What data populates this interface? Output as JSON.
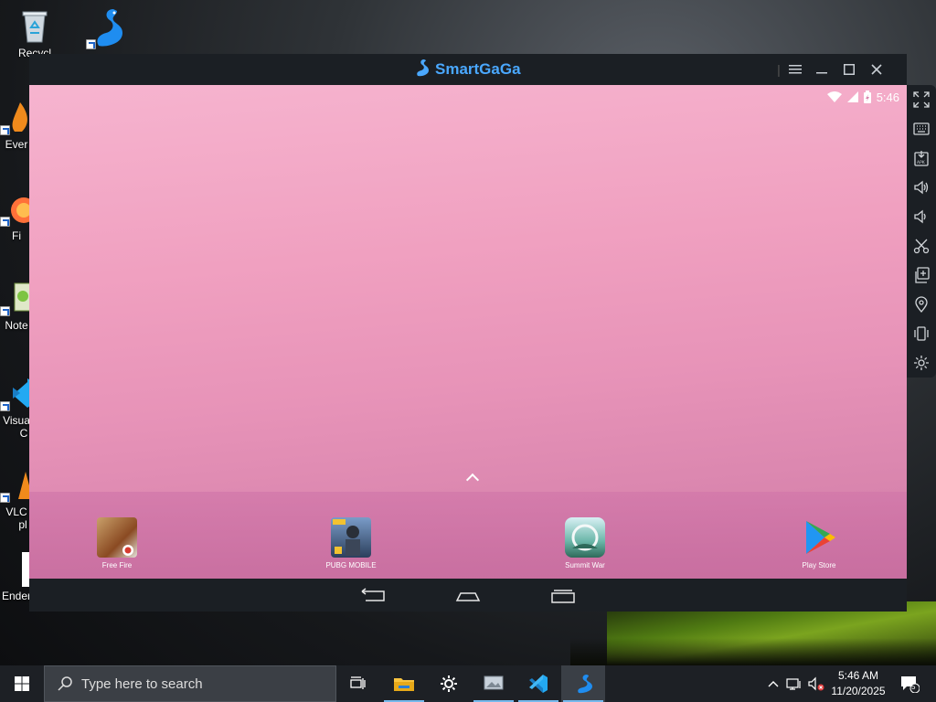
{
  "desktop": {
    "icons": [
      {
        "label": "Recycl"
      },
      {
        "label": "Ever"
      },
      {
        "label": "Fi"
      },
      {
        "label": "Note"
      },
      {
        "label": "Visua"
      },
      {
        "label": "C"
      },
      {
        "label": "VLC"
      },
      {
        "label": "pl"
      },
      {
        "label": "Enderm"
      }
    ]
  },
  "emulator": {
    "title": "SmartGaGa",
    "status_bar": {
      "time": "5:46"
    },
    "dock_apps": [
      {
        "label": "Free Fire"
      },
      {
        "label": "PUBG MOBILE"
      },
      {
        "label": "Summit War"
      },
      {
        "label": "Play Store"
      }
    ],
    "toolbar": [
      "fullscreen-icon",
      "keyboard-icon",
      "apk-install-icon",
      "volume-up-icon",
      "volume-down-icon",
      "screenshot-scissors-icon",
      "multi-instance-icon",
      "location-icon",
      "shake-icon",
      "settings-icon"
    ]
  },
  "taskbar": {
    "search_placeholder": "Type here to search",
    "clock_time": "5:46 AM",
    "clock_date": "11/20/2025",
    "notification_count": "5"
  },
  "colors": {
    "accent": "#4aa8ff",
    "taskbar": "#1d2025",
    "emulator_frame": "#1b1f24",
    "wallpaper_pink": "#f0a0c0"
  }
}
